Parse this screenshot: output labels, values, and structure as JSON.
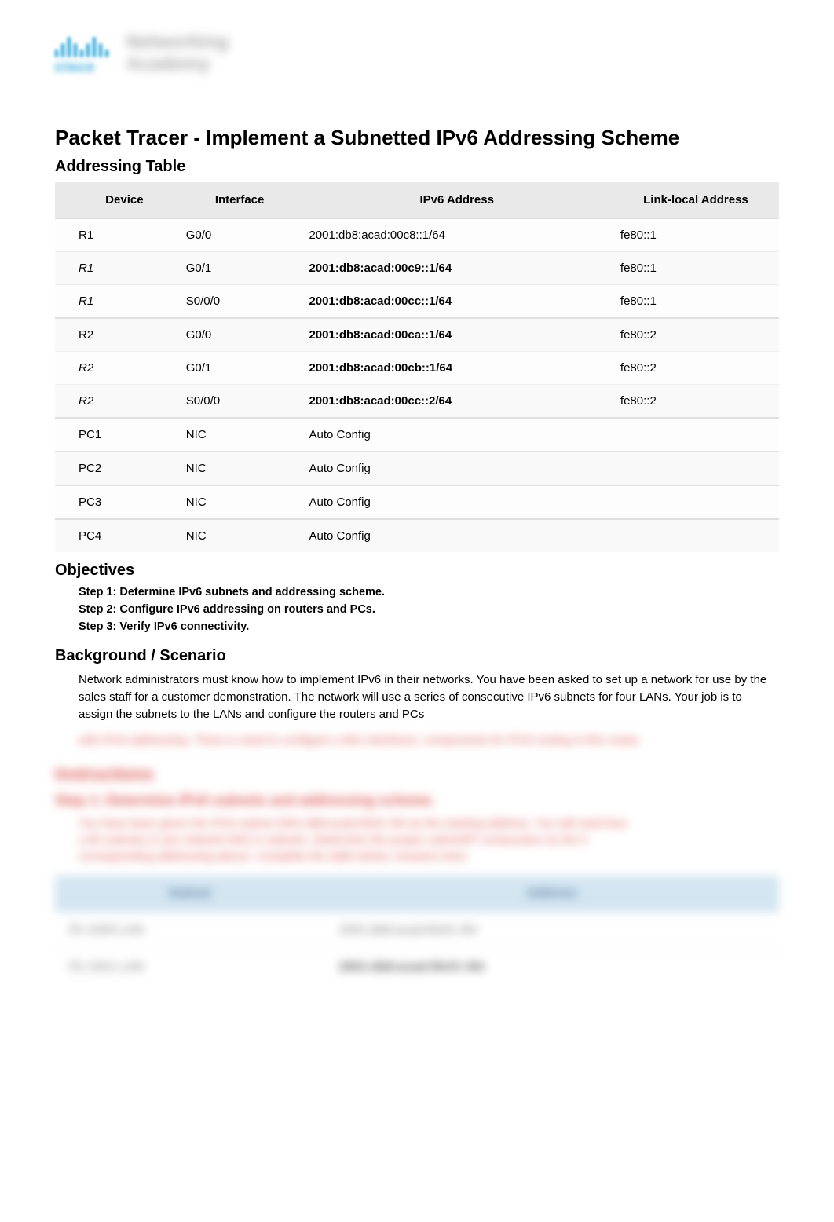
{
  "logo": {
    "brand": "cisco",
    "line1": "Networking",
    "line2": "Academy"
  },
  "title": "Packet Tracer - Implement a Subnetted IPv6 Addressing Scheme",
  "addressing": {
    "heading": "Addressing Table",
    "headers": {
      "device": "Device",
      "interface": "Interface",
      "ipv6": "IPv6 Address",
      "linklocal": "Link-local Address"
    },
    "rows": [
      {
        "device": "R1",
        "italic": false,
        "interface": "G0/0",
        "ipv6": "2001:db8:acad:00c8::1/64",
        "ip_bold": false,
        "linklocal": "fe80::1",
        "groupstart": true
      },
      {
        "device": "R1",
        "italic": true,
        "interface": "G0/1",
        "ipv6": "2001:db8:acad:00c9::1/64",
        "ip_bold": true,
        "linklocal": "fe80::1",
        "groupstart": false
      },
      {
        "device": "R1",
        "italic": true,
        "interface": "S0/0/0",
        "ipv6": "2001:db8:acad:00cc::1/64",
        "ip_bold": true,
        "linklocal": "fe80::1",
        "groupstart": false
      },
      {
        "device": "R2",
        "italic": false,
        "interface": "G0/0",
        "ipv6": "2001:db8:acad:00ca::1/64",
        "ip_bold": true,
        "linklocal": "fe80::2",
        "groupstart": true
      },
      {
        "device": "R2",
        "italic": true,
        "interface": "G0/1",
        "ipv6": "2001:db8:acad:00cb::1/64",
        "ip_bold": true,
        "linklocal": "fe80::2",
        "groupstart": false
      },
      {
        "device": "R2",
        "italic": true,
        "interface": "S0/0/0",
        "ipv6": "2001:db8:acad:00cc::2/64",
        "ip_bold": true,
        "linklocal": "fe80::2",
        "groupstart": false
      },
      {
        "device": "PC1",
        "italic": false,
        "interface": "NIC",
        "ipv6": "Auto Config",
        "ip_bold": false,
        "linklocal": "",
        "groupstart": true
      },
      {
        "device": "PC2",
        "italic": false,
        "interface": "NIC",
        "ipv6": "Auto Config",
        "ip_bold": false,
        "linklocal": "",
        "groupstart": true
      },
      {
        "device": "PC3",
        "italic": false,
        "interface": "NIC",
        "ipv6": "Auto Config",
        "ip_bold": false,
        "linklocal": "",
        "groupstart": true
      },
      {
        "device": "PC4",
        "italic": false,
        "interface": "NIC",
        "ipv6": "Auto Config",
        "ip_bold": false,
        "linklocal": "",
        "groupstart": true
      }
    ]
  },
  "objectives": {
    "heading": "Objectives",
    "steps": [
      "Step 1: Determine IPv6 subnets and addressing scheme.",
      "Step 2: Configure IPv6 addressing on routers and PCs.",
      "Step 3: Verify IPv6 connectivity."
    ]
  },
  "background": {
    "heading": "Background / Scenario",
    "text": "Network administrators must know how to implement IPv6 in their networks. You have been asked to set up a network for use by the sales staff for a customer demonstration. The network will use a series of consecutive IPv6 subnets for four LANs. Your job is to assign the subnets to the LANs and configure the routers and PCs"
  },
  "blurred": {
    "red_line": "with IPv6 addressing. There is need to configure LANs interfaces, components for IPv6 routing in this router.",
    "instructions": "Instructions",
    "step_heading": "Step 1: Determine IPv6 subnets and addressing scheme.",
    "step_text_1": "You have been given the IPv6 subnet 2001:db8:acad:00c8::/64 as the starting address. You will need four",
    "step_text_2": "LAN subnets (1 per network link) in subnets. Determine the proper subnet/IP consecutive as the 5",
    "step_text_3": "corresponding addressing above. Complete the table below. Answers here.",
    "table": {
      "h1": "Subnet",
      "h2": "Address",
      "r1c1": "R1 G0/0 LAN",
      "r1c2": "2001:db8:acad:00c8::/64",
      "r2c1": "R1 G0/1 LAN",
      "r2c2": "2001:db8:acad:00c9::/64"
    }
  }
}
